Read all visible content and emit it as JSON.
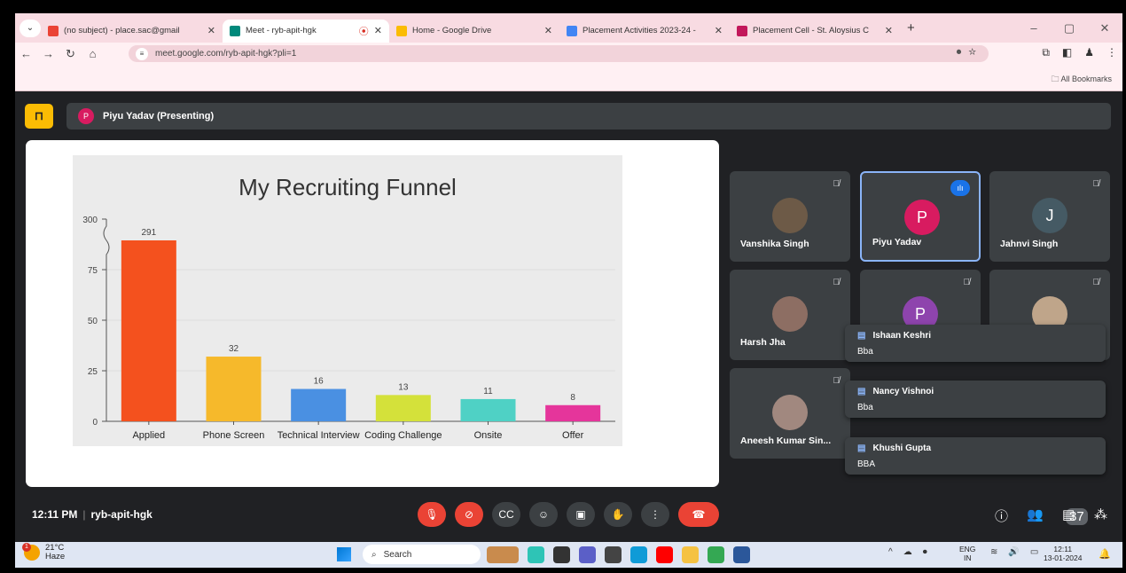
{
  "browser": {
    "tabs": [
      {
        "label": "(no subject) - place.sac@gmail",
        "color": "#ea4335"
      },
      {
        "label": "Meet - ryb-apit-hgk",
        "color": "#00897b"
      },
      {
        "label": "Home - Google Drive",
        "color": "#fbbc04"
      },
      {
        "label": "Placement Activities 2023-24 -",
        "color": "#4285f4"
      },
      {
        "label": "Placement Cell - St. Aloysius C",
        "color": "#c2185b"
      }
    ],
    "url": "meet.google.com/ryb-apit-hgk?pli=1",
    "all_bookmarks": "All Bookmarks"
  },
  "meet": {
    "presenter_initial": "P",
    "presenter_label": "Piyu Yadav (Presenting)",
    "time": "12:11 PM",
    "code": "ryb-apit-hgk",
    "participant_count": "37",
    "tiles": [
      {
        "name": "Vanshika Singh",
        "initial": "",
        "avatar": "#6d5a47"
      },
      {
        "name": "Piyu Yadav",
        "initial": "P",
        "avatar": "#d81b60"
      },
      {
        "name": "Jahnvi Singh",
        "initial": "J",
        "avatar": "#455a64"
      },
      {
        "name": "Harsh Jha",
        "initial": "",
        "avatar": "#8d6e63"
      },
      {
        "name": "",
        "initial": "P",
        "avatar": "#8e44ad"
      },
      {
        "name": "",
        "initial": "",
        "avatar": "#bfa58a"
      },
      {
        "name": "Aneesh Kumar Sin...",
        "initial": "",
        "avatar": "#a1887f"
      }
    ],
    "chat": [
      {
        "name": "Ishaan Keshri",
        "msg": "Bba"
      },
      {
        "name": "Nancy Vishnoi",
        "msg": "Bba"
      },
      {
        "name": "Khushi Gupta",
        "msg": "BBA"
      }
    ]
  },
  "chart_data": {
    "type": "bar",
    "title": "My Recruiting Funnel",
    "categories": [
      "Applied",
      "Phone Screen",
      "Technical Interview",
      "Coding Challenge",
      "Onsite",
      "Offer"
    ],
    "values": [
      291,
      32,
      16,
      13,
      11,
      8
    ],
    "colors": [
      "#f4511e",
      "#f6b92b",
      "#4a90e2",
      "#d4e13a",
      "#4fd1c5",
      "#e5359b"
    ],
    "yticks": [
      "0",
      "25",
      "50",
      "75",
      "300"
    ],
    "axis_break": true,
    "ylim": [
      0,
      300
    ]
  },
  "taskbar": {
    "temp": "21°C",
    "weather": "Haze",
    "weather_badge": "1",
    "search": "Search",
    "lang1": "ENG",
    "lang2": "IN",
    "time": "12:11",
    "date": "13-01-2024"
  }
}
